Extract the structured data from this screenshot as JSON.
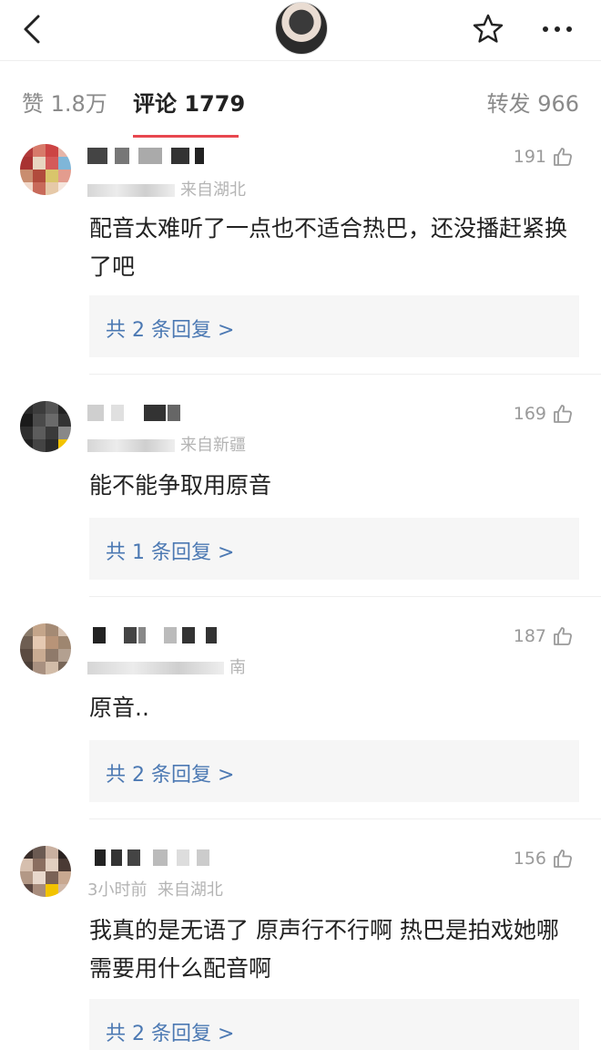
{
  "tabs": {
    "likes": "赞 1.8万",
    "comments": "评论 1779",
    "reposts": "转发 966"
  },
  "icons": {
    "back": "chevron-left-icon",
    "star": "star-outline-icon",
    "more": "more-horizontal-icon",
    "like": "thumbs-up-icon"
  },
  "comments": [
    {
      "meta_suffix": "来自湖北",
      "likes": "191",
      "text": "配音太难听了一点也不适合热巴，还没播赶紧换了吧",
      "reply": "共 2 条回复 >"
    },
    {
      "meta_suffix": "来自新疆",
      "likes": "169",
      "text": "能不能争取用原音",
      "reply": "共 1 条回复 >"
    },
    {
      "meta_suffix": "南",
      "likes": "187",
      "text": "原音..",
      "reply": "共 2 条回复 >"
    },
    {
      "meta_prefix": "3小时前",
      "meta_suffix": "来自湖北",
      "likes": "156",
      "text": "我真的是无语了 原声行不行啊 热巴是拍戏她哪需要用什么配音啊",
      "reply": "共 2 条回复 >"
    }
  ],
  "colors": {
    "accent_underline": "#e8474f",
    "reply_link": "#4c79b3",
    "muted_text": "#8a8a8a"
  }
}
